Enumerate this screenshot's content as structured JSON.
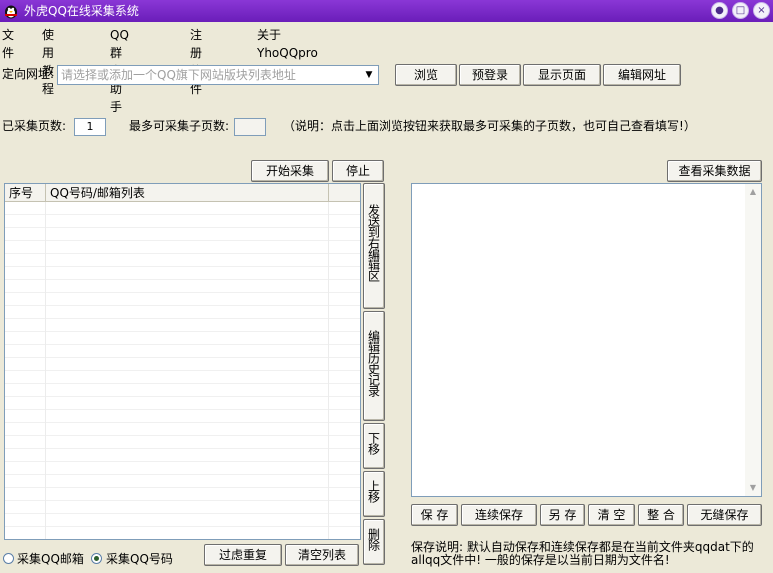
{
  "window": {
    "title": "外虎QQ在线采集系统",
    "min_glyph": "●",
    "max_glyph": "□",
    "close_glyph": "×"
  },
  "menu": [
    "文件",
    "使用教程",
    "QQ群发助手",
    "注册软件",
    "关于YhoQQpro"
  ],
  "url_row": {
    "label": "定向网址:",
    "placeholder": "请选择或添加一个QQ旗下网站版块列表地址",
    "dropdown_glyph": "▼",
    "buttons": [
      "浏览",
      "预登录",
      "显示页面",
      "编辑网址"
    ]
  },
  "pages_row": {
    "collected_label": "已采集页数:",
    "collected_value": "1",
    "max_label": "最多可采集子页数:",
    "max_value": "",
    "note": "（说明：点击上面浏览按钮来获取最多可采集的子页数，也可自己查看填写!）"
  },
  "left_panel": {
    "start_button": "开始采集",
    "stop_button": "停止",
    "columns": [
      "序号",
      "QQ号码/邮箱列表"
    ],
    "side_buttons": [
      "发送到右编辑区",
      "编辑历史记录",
      "下移",
      "上移",
      "删除"
    ],
    "radio_email": "采集QQ邮箱",
    "radio_qq": "采集QQ号码",
    "dedupe_button": "过虑重复",
    "clear_button": "清空列表"
  },
  "right_panel": {
    "view_button": "查看采集数据",
    "buttons": [
      "保 存",
      "连续保存",
      "另 存",
      "清 空",
      "整 合",
      "无缝保存"
    ],
    "save_note": "保存说明: 默认自动保存和连续保存都是在当前文件夹qqdat下的allqq文件中! 一般的保存是以当前日期为文件名!",
    "scroll_up": "▲",
    "scroll_down": "▼"
  }
}
